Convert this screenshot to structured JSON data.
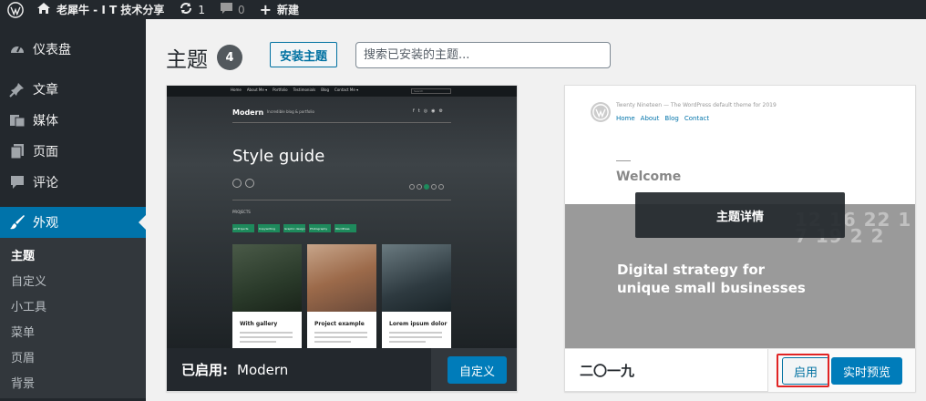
{
  "adminbar": {
    "site_name": "老犀牛 - I T 技术分享",
    "updates_count": "1",
    "comments_count": "0",
    "new_label": "新建"
  },
  "sidebar": {
    "items": [
      {
        "label": "仪表盘",
        "icon": "dashboard-icon"
      },
      {
        "label": "文章",
        "icon": "pin-icon"
      },
      {
        "label": "媒体",
        "icon": "media-icon"
      },
      {
        "label": "页面",
        "icon": "page-icon"
      },
      {
        "label": "评论",
        "icon": "comment-icon"
      },
      {
        "label": "外观",
        "icon": "brush-icon"
      }
    ],
    "submenu": [
      "主题",
      "自定义",
      "小工具",
      "菜单",
      "页眉",
      "背景"
    ]
  },
  "main": {
    "title": "主题",
    "count": "4",
    "install_label": "安装主题",
    "search_placeholder": "搜索已安装的主题..."
  },
  "themes": [
    {
      "preview": {
        "nav": [
          "Home",
          "About Me ▾",
          "Portfolio",
          "Testimonials",
          "Blog",
          "Contact Me ▾"
        ],
        "search": "Search",
        "brand": "Modern",
        "tagline": "Incredible blog & portfolio",
        "headline": "Style guide",
        "section": "PROJECTS",
        "tags": [
          "All Projects",
          "Copywriting",
          "Graphic design",
          "Photography",
          "WordPress"
        ],
        "tiles": [
          "With gallery",
          "Project example",
          "Lorem ipsum dolor"
        ]
      },
      "active_prefix": "已启用:",
      "name": "Modern",
      "customize_label": "自定义"
    },
    {
      "preview": {
        "site": "Twenty Nineteen — The WordPress default theme for 2019",
        "menu": [
          "Home",
          "About",
          "Blog",
          "Contact"
        ],
        "welcome": "Welcome",
        "digits": "12 16 22 17 19 2 2",
        "strategy_line1": "Digital strategy for",
        "strategy_line2": "unique small businesses"
      },
      "details_label": "主题详情",
      "name": "二〇一九",
      "activate_label": "启用",
      "preview_label": "实时预览"
    }
  ],
  "colors": {
    "adminbar_bg": "#23282d",
    "accent": "#0073aa",
    "primary_button": "#007cba",
    "highlight": "#e02424"
  }
}
